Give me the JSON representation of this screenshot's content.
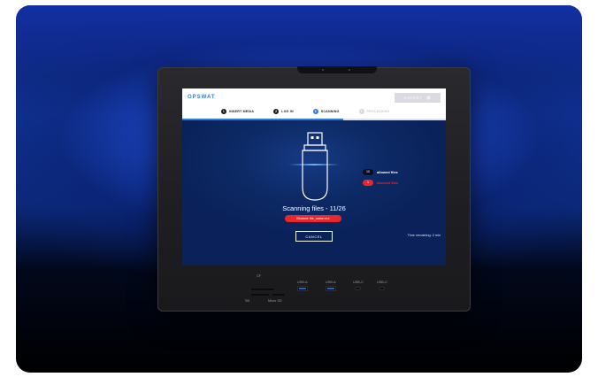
{
  "brand": "OPSWAT",
  "top_button": {
    "label": "EXPORT",
    "icon": "settings-icon"
  },
  "steps": [
    {
      "num": "1",
      "label": "INSERT MEDIA",
      "state": "done"
    },
    {
      "num": "2",
      "label": "LOG IN",
      "state": "done"
    },
    {
      "num": "3",
      "label": "SCANNING",
      "state": "active"
    },
    {
      "num": "4",
      "label": "PROCESSING",
      "state": "pending"
    }
  ],
  "progress": {
    "completed_fraction": 0.61
  },
  "scan": {
    "status": "Scanning files - 11/26",
    "blocked_file": "Blocked: file_name.exe",
    "cancel_label": "CANCEL",
    "time_remaining": "Time remaining: 2 min"
  },
  "files": {
    "allowed_count": "10",
    "allowed_label": "allowed files",
    "blocked_count": "1",
    "blocked_label": "blocked files"
  },
  "ports": {
    "cf": "CF",
    "sd": "SD",
    "micro_sd": "Micro SD",
    "usb_a_1": "USB-A",
    "usb_a_2": "USB-A",
    "usb_c_1": "USB-C",
    "usb_c_2": "USB-C"
  },
  "colors": {
    "accent": "#2a7de1",
    "danger": "#e8262b",
    "screen_bg": "#0d2a66"
  }
}
